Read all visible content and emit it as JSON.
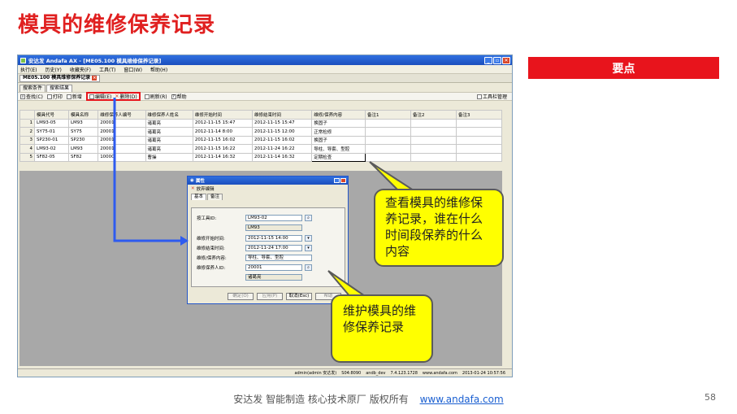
{
  "slide": {
    "title": "模具的维修保养记录",
    "keypoint_label": "要点",
    "footer_text": "安达发   智能制造 核心技术原厂   版权所有",
    "footer_url": "www.andafa.com",
    "page_number": "58"
  },
  "callouts": {
    "view_records": "查看模具的维修保养记录，谁在什么时间段保养的什么内容",
    "maintain_records": "维护模具的维修保养记录"
  },
  "app": {
    "window_title": "安达发 Andafa AX - [ME05.100 模具维修保养记录]",
    "menus": [
      "执行(E)",
      "历史(Y)",
      "收藏夹(F)",
      "工具(T)",
      "窗口(W)",
      "帮助(H)"
    ],
    "doc_tab": "ME05.100 模具维修保养记录",
    "subtabs": [
      "搜索条件",
      "搜索结果"
    ],
    "toolbar": {
      "search": "查找(C)",
      "print": "打印",
      "new": "新增",
      "edit": "编辑(E)",
      "delete": "删除(D)",
      "refresh": "刷新(R)",
      "help": "帮助",
      "toolbar_manage": "工具栏管理"
    },
    "columns": [
      "模具代号",
      "模具名称",
      "维修保养人编号",
      "维修保养人姓名",
      "维修开始时间",
      "维修结束时间",
      "维修/保养内容",
      "备注1",
      "备注2",
      "备注3"
    ],
    "rows": [
      {
        "n": "1",
        "cells": [
          "LM93-05",
          "LM93",
          "20001",
          "诸葛亮",
          "2012-11-15 15:47",
          "2012-11-15 15:47",
          "换固子",
          "",
          "",
          ""
        ]
      },
      {
        "n": "2",
        "cells": [
          "SY75-01",
          "SY75",
          "20001",
          "诸葛亮",
          "2012-11-14 8:00",
          "2012-11-15 12:00",
          "正常检修",
          "",
          "",
          ""
        ]
      },
      {
        "n": "3",
        "cells": [
          "SP230-01",
          "SP230",
          "20001",
          "诸葛亮",
          "2012-11-15 16:02",
          "2012-11-15 16:02",
          "换固子",
          "",
          "",
          ""
        ]
      },
      {
        "n": "4",
        "cells": [
          "LM93-02",
          "LM93",
          "20001",
          "诸葛亮",
          "2012-11-15 16:22",
          "2012-11-24 16:22",
          "导柱、导套、型腔",
          "",
          "",
          ""
        ]
      },
      {
        "n": "5",
        "cells": [
          "SF82-05",
          "SF82",
          "10000",
          "曹操",
          "2012-11-14 16:32",
          "2012-11-14 16:32",
          "定期检查",
          "",
          "",
          ""
        ]
      }
    ],
    "status": {
      "user": "admin(admin 安达发)",
      "server": "S04:8090",
      "db": "andb_dev",
      "version": "7.4.123.1728",
      "site": "www.andafa.com",
      "datetime": "2013-01-24 10:57:56"
    }
  },
  "dialog": {
    "title": "属性",
    "tool": "放弃编辑",
    "tabs": [
      "基本",
      "备注"
    ],
    "fields": {
      "tool_id_label": "按工具ID:",
      "tool_id": "LM93-02",
      "tool_name": "LM93",
      "start_label": "维修开始时间:",
      "start": "2012-11-15 14:00",
      "end_label": "维修结束时间:",
      "end": "2012-11-24 17:00",
      "content_label": "维修/保养内容:",
      "content": "导柱、导套、型腔",
      "person_label": "维修保养人ID:",
      "person_id": "20001",
      "person_name": "诸葛亮"
    },
    "buttons": [
      "确定(O)",
      "应用(P)",
      "取消(Esc)",
      "帮助"
    ]
  },
  "colors": {
    "title_red": "#e02020",
    "keypoint_bg": "#e8141c",
    "callout_yellow": "#ffff00",
    "arrow_blue": "#2e5bef"
  }
}
